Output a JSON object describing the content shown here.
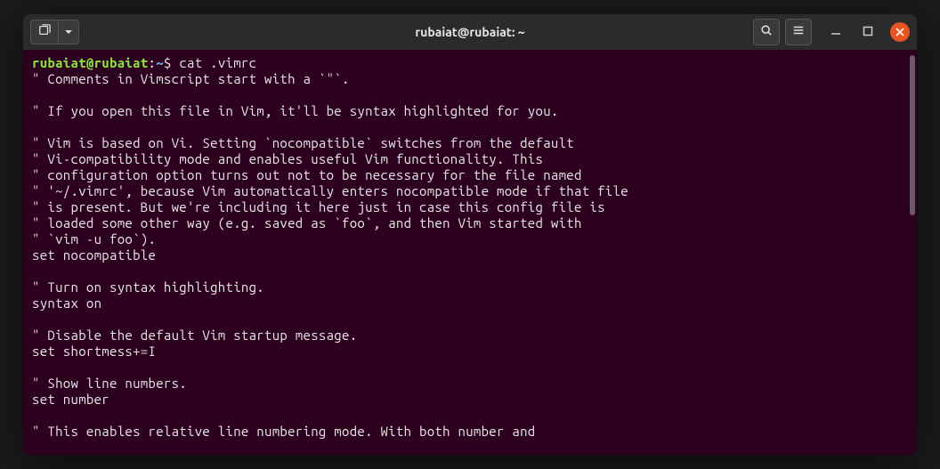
{
  "titlebar": {
    "title": "rubaiat@rubaiat: ~"
  },
  "prompt": {
    "user_host": "rubaiat@rubaiat",
    "colon": ":",
    "path": "~",
    "dollar": "$",
    "command": " cat .vimrc"
  },
  "output": {
    "lines": [
      "\" Comments in Vimscript start with a `\"`.",
      "",
      "\" If you open this file in Vim, it'll be syntax highlighted for you.",
      "",
      "\" Vim is based on Vi. Setting `nocompatible` switches from the default",
      "\" Vi-compatibility mode and enables useful Vim functionality. This",
      "\" configuration option turns out not to be necessary for the file named",
      "\" '~/.vimrc', because Vim automatically enters nocompatible mode if that file",
      "\" is present. But we're including it here just in case this config file is",
      "\" loaded some other way (e.g. saved as `foo`, and then Vim started with",
      "\" `vim -u foo`).",
      "set nocompatible",
      "",
      "\" Turn on syntax highlighting.",
      "syntax on",
      "",
      "\" Disable the default Vim startup message.",
      "set shortmess+=I",
      "",
      "\" Show line numbers.",
      "set number",
      "",
      "\" This enables relative line numbering mode. With both number and"
    ]
  }
}
